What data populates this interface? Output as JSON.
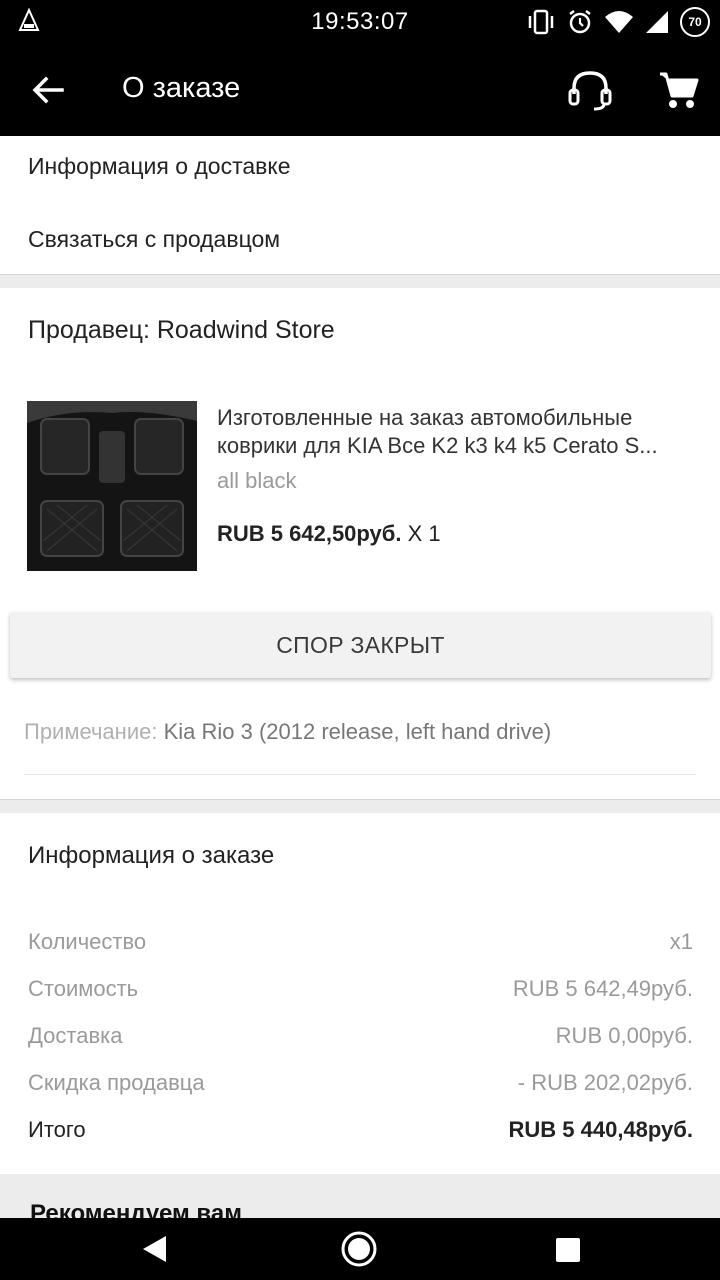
{
  "status_bar": {
    "time": "19:53:07",
    "battery": "70"
  },
  "app_bar": {
    "title": "О заказе",
    "icons": [
      "back-arrow-icon",
      "headset-icon",
      "cart-icon"
    ]
  },
  "links": {
    "delivery_info": "Информация о доставке",
    "contact_seller": "Связаться с продавцом"
  },
  "seller": {
    "label": "Продавец: Roadwind Store"
  },
  "product": {
    "title_line1": "Изготовленные на заказ автомобильные",
    "title_line2": "коврики для KIA Все K2 k3 k4 k5 Cerato S...",
    "variant": "all black",
    "price": "RUB 5 642,50руб.",
    "quantity": "X 1"
  },
  "dispute_button": "СПОР ЗАКРЫТ",
  "note": {
    "label": "Примечание:",
    "text": "Kia Rio 3 (2012 release, left hand drive)"
  },
  "order_info": {
    "title": "Информация о заказе",
    "rows": [
      {
        "label": "Количество",
        "value": "x1"
      },
      {
        "label": "Стоимость",
        "value": "RUB 5 642,49руб."
      },
      {
        "label": "Доставка",
        "value": "RUB 0,00руб."
      },
      {
        "label": "Скидка продавца",
        "value": "- RUB 202,02руб."
      },
      {
        "label": "Итого",
        "value": "RUB 5 440,48руб."
      }
    ]
  },
  "recommend": {
    "title": "Рекомендуем вам"
  }
}
